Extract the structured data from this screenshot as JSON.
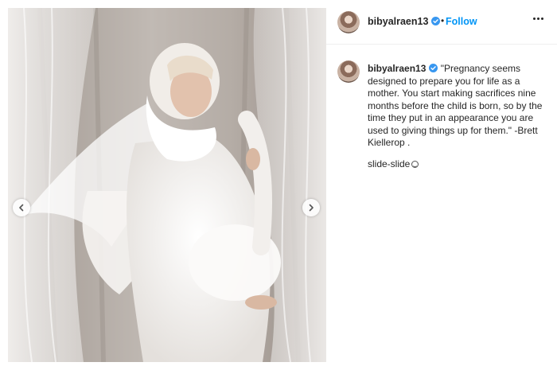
{
  "post": {
    "username": "bibyalraen13",
    "dot_separator": "•",
    "follow_label": "Follow",
    "more_icon": "more-options-icon",
    "caption": {
      "username": "bibyalraen13",
      "text": "\"Pregnancy seems designed to prepare you for life as a mother. You start making sacrifices nine months before the child is born, so by the time they put in an appearance you are used to giving things up for them.\" -Brett Kiellerop .",
      "extra": "slide-slide"
    },
    "media": {
      "prev_icon": "chevron-left-icon",
      "next_icon": "chevron-right-icon"
    },
    "colors": {
      "follow_blue": "#0095f6",
      "verified_blue": "#3897f0",
      "text": "#262626"
    }
  }
}
